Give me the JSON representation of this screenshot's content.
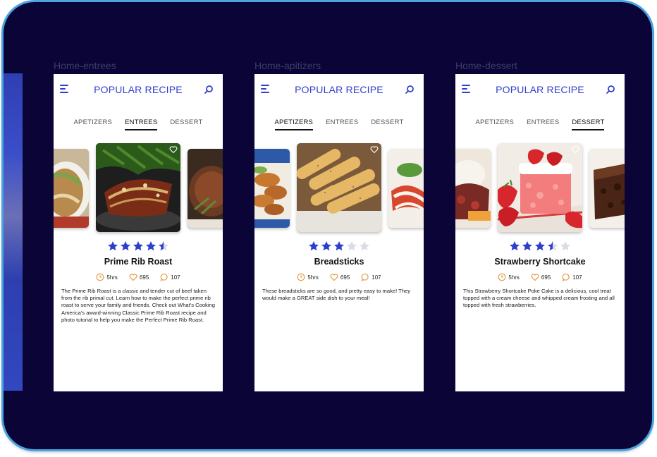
{
  "artboards": [
    {
      "label": "Home-entrees",
      "app_title": "POPULAR RECIPE",
      "tabs": [
        "APETIZERS",
        "ENTREES",
        "DESSERT"
      ],
      "active_tab": 1,
      "recipe": {
        "name": "Prime Rib Roast",
        "rating": 4.5,
        "rating_max": 5,
        "time": "5hrs",
        "likes": "695",
        "comments": "107",
        "description": "The Prime Rib Roast is a classic and tender cut of beef taken from the rib primal cut.  Learn how to make the perfect prime rib roast to serve your family and friends.  Check out What's Cooking America's award-winning Classic Prime Rib Roast recipe and photo tutorial to help you make the Perfect Prime Rib Roast."
      }
    },
    {
      "label": "Home-apitizers",
      "app_title": "POPULAR RECIPE",
      "tabs": [
        "APETIZERS",
        "ENTREES",
        "DESSERT"
      ],
      "active_tab": 0,
      "recipe": {
        "name": "Breadsticks",
        "rating": 3,
        "rating_max": 5,
        "time": "5hrs",
        "likes": "695",
        "comments": "107",
        "description": "These breadsticks are so good, and pretty easy to make! They would make a GREAT side dish to your meal!"
      }
    },
    {
      "label": "Home-dessert",
      "app_title": "POPULAR RECIPE",
      "tabs": [
        "APETIZERS",
        "ENTREES",
        "DESSERT"
      ],
      "active_tab": 2,
      "recipe": {
        "name": "Strawberry Shortcake",
        "rating": 3.5,
        "rating_max": 5,
        "time": "5hrs",
        "likes": "695",
        "comments": "107",
        "description": "This Strawberry Shortcake Poke Cake is a delicious, cool treat topped with a cream cheese and whipped cream frosting and all topped with fresh strawberries."
      }
    }
  ],
  "colors": {
    "canvas": "#0b0436",
    "frame_border": "#4aa3df",
    "accent": "#2f3fcc",
    "star_empty": "#d9dbe6",
    "meta_icon": "#e0953a"
  },
  "icons": {
    "menu": "hamburger-menu-icon",
    "search": "search-icon",
    "favorite": "heart-outline-icon",
    "time": "clock-icon",
    "likes": "heart-icon",
    "comments": "comment-bubble-icon"
  }
}
